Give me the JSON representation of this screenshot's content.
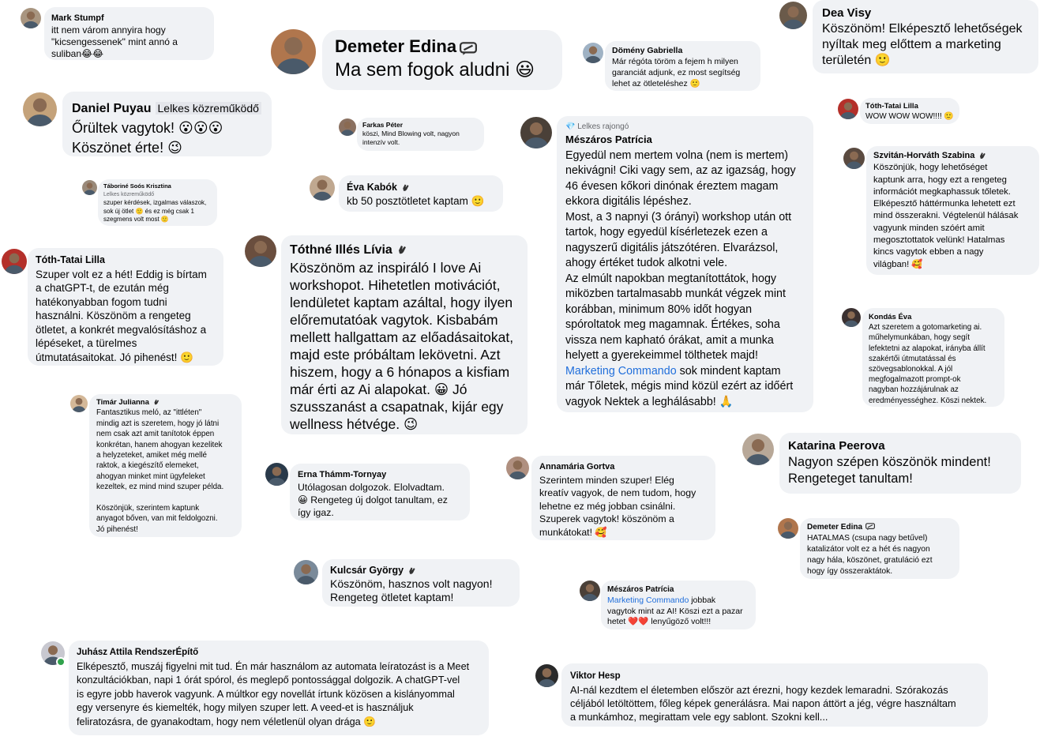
{
  "comments": [
    {
      "id": "mark",
      "name": "Mark Stumpf",
      "text": "itt nem várom annyira hogy\n\"kicsengessenek\" mint annó a\nsuliban😂😂"
    },
    {
      "id": "demeter1",
      "name": "Demeter Edina",
      "text": "Ma sem fogok aludni 😃"
    },
    {
      "id": "domeny",
      "name": "Dömény Gabriella",
      "text": "Már régóta töröm a fejem h milyen\ngaranciát adjunk, ez most segítség\nlehet az ötleteléshez 🙂"
    },
    {
      "id": "dea",
      "name": "Dea Visy",
      "text": "Köszönöm! Elképesztő lehetőségek\nnyíltak meg előttem a marketing\nterületén 🙂"
    },
    {
      "id": "daniel",
      "name": "Daniel Puyau",
      "badge": "Lelkes közreműködő",
      "text": "Őrültek vagytok! 😮😮😮\nKöszönet érte! 😉"
    },
    {
      "id": "farkas",
      "name": "Farkas Péter",
      "text": "köszi, Mind Blowing volt, nagyon\nintenzív volt."
    },
    {
      "id": "tothtatai1",
      "name": "Tóth-Tatai Lilla",
      "text": "WOW WOW WOW!!!! 🙂"
    },
    {
      "id": "meszaros1",
      "name": "Mészáros Patrícia",
      "role": "Lelkes rajongó",
      "text": "Egyedül nem mertem volna (nem is mertem)\nnekivágni! Ciki vagy sem, az az igazság, hogy\n46 évesen kőkori dinónak éreztem magam\nekkora digitális lépéshez.\nMost, a 3 napnyi (3 órányi) workshop után ott\ntartok, hogy egyedül kísérletezek ezen a\nnagyszerű digitális játszótéren. Elvarázsol,\nahogy értéket tudok alkotni vele.\nAz elmúlt napokban megtanítottátok, hogy\nmiközben tartalmasabb munkát végzek mint\nkorábban, minimum 80% időt hogyan\nspóroltatok meg magamnak. Értékes, soha\nvissza nem kapható órákat, amit a munka\nhelyett a gyerekeimmel tölthetek majd!",
      "link": "Marketing Commando",
      "text2": " sok mindent kaptam\nmár Tőletek, mégis mind közül ezért az időért\nvagyok Nektek a leghálásabb! 🙏"
    },
    {
      "id": "szvitan",
      "name": "Szvitán-Horváth Szabina",
      "text": "Köszönjük, hogy lehetőséget\nkaptunk arra, hogy ezt a rengeteg\ninformációt megkaphassuk tőletek.\nElképesztő háttérmunka lehetett ezt\nmind összerakni. Végtelenül hálásak\nvagyunk minden szóért amit\nmegosztottatok velünk! Hatalmas\nkincs vagytok ebben a nagy\nvilágban! 🥰"
    },
    {
      "id": "taborine",
      "name": "Táboriné Soós Krisztina",
      "role": "Lelkes közreműködő",
      "text": "szuper kérdések, izgalmas válaszok,\nsok új ötlet 🙂 és ez még csak 1\nszegmens volt most 🙂"
    },
    {
      "id": "eva",
      "name": "Éva Kabók",
      "text": "kb 50 posztötletet kaptam 🙂"
    },
    {
      "id": "tothtatai2",
      "name": "Tóth-Tatai Lilla",
      "text": "Szuper volt ez a hét! Eddig is bírtam\na chatGPT-t, de ezután még\nhatékonyabban fogom tudni\nhasználni. Köszönöm a rengeteg\nötletet, a konkrét megvalósításhoz a\nlépéseket, a türelmes\nútmutatásaitokat. Jó pihenést! 🙂"
    },
    {
      "id": "tothne",
      "name": "Tóthné Illés Lívia",
      "text": "Köszönöm az inspiráló I love Ai\nworkshopot. Hihetetlen motivációt,\nlendületet kaptam azáltal, hogy ilyen\nelőremutatóak vagytok. Kisbabám\nmellett hallgattam az előadásaitokat,\nmajd este próbáltam lekövetni. Azt\nhiszem, hogy a 6 hónapos a kisfiam\nmár érti az Ai alapokat. 😀 Jó\nszusszanást a csapatnak, kijár egy\nwellness hétvége. 😉"
    },
    {
      "id": "kondas",
      "name": "Kondás Éva",
      "text": "Azt szeretem a gotomarketing ai.\nműhelymunkában, hogy segít\nlefektetni az alapokat, irányba állít\nszakértői útmutatással és\nszövegsablonokkal. A jól\nmegfogalmazott  prompt-ok\nnagyban hozzájárulnak az\neredményességhez. Köszi nektek."
    },
    {
      "id": "timar",
      "name": "Timár Julianna",
      "text": "Fantasztikus meló, az \"itt​léten\"\nmindig azt is szeretem, hogy jó látni\nnem csak azt amit tanítotok éppen\nkonkrétan, hanem ahogyan kezelitek\na helyzeteket, amiket még mellé\nraktok, a kiegészítő elemeket,\nahogyan minket mint ügyfeleket\nkezeltek, ez mind mind szuper példa.\n\nKöszönjük, szerintem kaptunk\nanyagot bőven, van mit feldolgozni.\nJó pihenést!"
    },
    {
      "id": "katarina",
      "name": "Katarina Peerova",
      "text": "Nagyon szépen köszönök mindent!\nRengeteget tanultam!"
    },
    {
      "id": "erna",
      "name": "Erna Thámm-Tornyay",
      "text": "Utólagosan dolgozok. Elolvadtam.\n😀 Rengeteg új dolgot tanultam, ez\nígy igaz."
    },
    {
      "id": "annamaria",
      "name": "Annamária Gortva",
      "text": "Szerintem minden szuper! Elég\nkreatív vagyok, de nem tudom, hogy\nlehetne ez még jobban csinálni.\nSzuperek vagytok! köszönöm a\nmunkátokat! 🥰"
    },
    {
      "id": "demeter2",
      "name": "Demeter Edina",
      "text": "HATALMAS (csupa nagy betűvel)\nkatalizátor volt ez a hét és nagyon\nnagy hála, köszönet, gratuláció ezt\nhogy így összeraktátok."
    },
    {
      "id": "kulcsar",
      "name": "Kulcsár György",
      "text": "Köszönöm, hasznos volt nagyon!\nRengeteg ötletet kaptam!"
    },
    {
      "id": "meszaros2",
      "name": "Mészáros Patrícia",
      "link": "Marketing Commando",
      "text2": " jobbak\nvagytok mint az AI! Köszi ezt a pazar\nhetet ❤️❤️ lenyűgöző volt!!!"
    },
    {
      "id": "juhasz",
      "name": "Juhász Attila RendszerÉpítő",
      "text": "Elképesztő, muszáj figyelni mit tud. Én már használom az automata leíratozást is a Meet\nkonzultációkban, napi 1 órát spórol, és meglepő pontossággal dolgozik. A chatGPT-vel\nis egyre jobb haverok vagyunk. A múltkor egy novellát írtunk közösen a kislányommal\negy versenyre és kiemelték, hogy milyen szuper lett. A veed-et is használjuk\nfeliratozásra, de gyanakodtam, hogy nem véletlenül olyan drága 🙂"
    },
    {
      "id": "viktor",
      "name": "Viktor Hesp",
      "text": "AI-nál kezdtem el életemben először azt érezni, hogy kezdek lemaradni. Szórakozás\ncéljából letöltöttem, főleg képek generálásra. Mai napon áttört a jég, végre használtam\na munkámhoz, megirattam vele egy sablont. Szokni kell..."
    }
  ]
}
